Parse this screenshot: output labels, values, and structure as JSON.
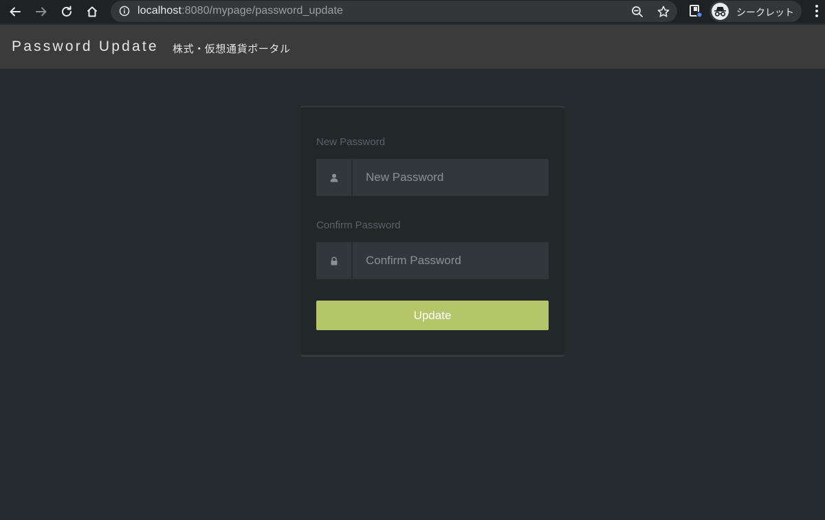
{
  "browser": {
    "url_host": "localhost",
    "url_rest": ":8080/mypage/password_update",
    "profile_label": "シークレット"
  },
  "header": {
    "title": "Password Update",
    "subtitle": "株式・仮想通貨ポータル"
  },
  "form": {
    "new_password": {
      "label": "New Password",
      "placeholder": "New Password",
      "value": "",
      "icon": "user-icon"
    },
    "confirm_password": {
      "label": "Confirm Password",
      "placeholder": "Confirm Password",
      "value": "",
      "icon": "lock-icon"
    },
    "submit_label": "Update"
  },
  "colors": {
    "page_bg": "#262b30",
    "header_bg": "#3b3b3b",
    "card_bg": "#22272a",
    "input_bg": "#32373c",
    "button_bg": "#b5c66a"
  }
}
